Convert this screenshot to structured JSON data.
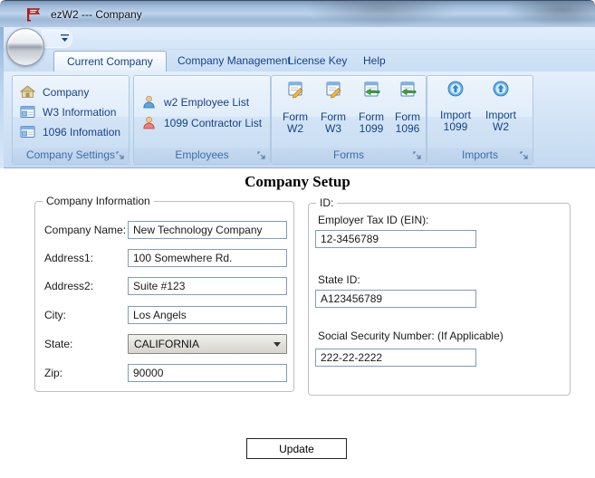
{
  "window": {
    "title": "ezW2 --- Company",
    "app_icon": "ezw2-flag-icon"
  },
  "ribbon": {
    "tabs": [
      {
        "label": "Current Company",
        "selected": true
      },
      {
        "label": "Company Management",
        "selected": false
      },
      {
        "label": "License Key",
        "selected": false
      },
      {
        "label": "Help",
        "selected": false
      }
    ],
    "groups": {
      "company_settings": {
        "caption": "Company Settings",
        "items": [
          {
            "label": "Company",
            "icon": "house-icon"
          },
          {
            "label": "W3 Information",
            "icon": "form-grid-icon"
          },
          {
            "label": "1096 Infomation",
            "icon": "form-grid-icon"
          }
        ]
      },
      "employees": {
        "caption": "Employees",
        "items": [
          {
            "label": "w2 Employee List",
            "icon": "person-blue-icon"
          },
          {
            "label": "1099 Contractor List",
            "icon": "person-red-icon"
          }
        ]
      },
      "forms": {
        "caption": "Forms",
        "items": [
          {
            "line1": "Form",
            "line2": "W2",
            "icon": "form-edit-icon"
          },
          {
            "line1": "Form",
            "line2": "W3",
            "icon": "form-edit-icon"
          },
          {
            "line1": "Form",
            "line2": "1099",
            "icon": "form-arrow-icon"
          },
          {
            "line1": "Form",
            "line2": "1096",
            "icon": "form-arrow-icon"
          }
        ]
      },
      "imports": {
        "caption": "Imports",
        "items": [
          {
            "line1": "Import",
            "line2": "1099",
            "icon": "import-icon"
          },
          {
            "line1": "Import",
            "line2": "W2",
            "icon": "import-icon"
          }
        ]
      }
    }
  },
  "content": {
    "heading": "Company Setup",
    "company_info": {
      "legend": "Company Information",
      "fields": [
        {
          "label": "Company Name:",
          "value": "New Technology Company",
          "type": "text"
        },
        {
          "label": "Address1:",
          "value": "100 Somewhere Rd.",
          "type": "text"
        },
        {
          "label": "Address2:",
          "value": "Suite #123",
          "type": "text"
        },
        {
          "label": "City:",
          "value": "Los Angels",
          "type": "text"
        },
        {
          "label": "State:",
          "value": "CALIFORNIA",
          "type": "select"
        },
        {
          "label": "Zip:",
          "value": "90000",
          "type": "text"
        }
      ]
    },
    "id_section": {
      "legend": "ID:",
      "fields": [
        {
          "label": "Employer Tax ID (EIN):",
          "value": "12-3456789"
        },
        {
          "label": "State ID:",
          "value": "A123456789"
        },
        {
          "label": "Social Security Number: (If Applicable)",
          "value": "222-22-2222"
        }
      ]
    },
    "update_label": "Update"
  },
  "colors": {
    "accent_text": "#15428b",
    "group_caption_text": "#3e6ca8",
    "titlebar_glass": "#a3bedc",
    "ribbon_bg": "#d3e4f6",
    "input_border": "#7f9db9"
  }
}
